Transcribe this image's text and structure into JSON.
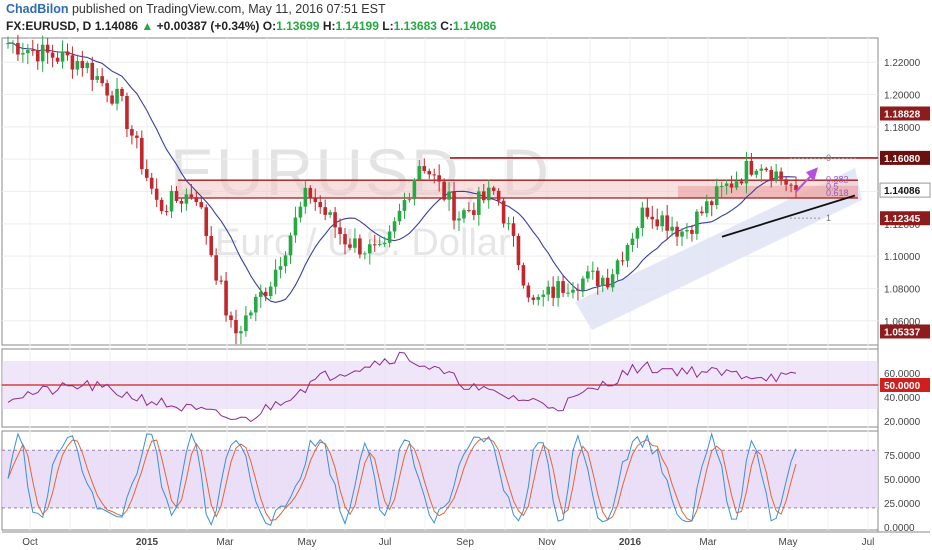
{
  "header": {
    "author": "ChadBilon",
    "published_text": "published on TradingView.com, May 11, 2016 07:51 EST",
    "symbol": "FX:EURUSD, D",
    "last": "1.14086",
    "change_arrow": "▲",
    "change": "+0.00387 (+0.34%)",
    "o_label": "O:",
    "o_value": "1.13699",
    "h_label": "H:",
    "h_value": "1.14199",
    "l_label": "L:",
    "l_value": "1.13683",
    "c_label": "C:",
    "c_value": "1.14086"
  },
  "watermark": {
    "line1": "EURUSD, D",
    "line2": "Euro / U.S. Dollar"
  },
  "colors": {
    "up": "#27a844",
    "down": "#c1272d",
    "resistance": "#a11b1b",
    "zone_fill": "#f4c6c6",
    "channel_fill": "#dfe3f5",
    "ma": "#3a3f9c",
    "rsi": "#8a2d8d",
    "stoch_k": "#3b8fd9",
    "stoch_d": "#e0673a",
    "osc_fill": "#e6d6f5",
    "arrow": "#b84fe0"
  },
  "chart_data": [
    {
      "type": "candlestick",
      "panel": "price",
      "title": "EURUSD, D",
      "subtitle": "Euro / U.S. Dollar",
      "ylim": [
        1.045,
        1.235
      ],
      "y_ticks": [
        "1.22000",
        "1.20000",
        "1.18000",
        "1.16000",
        "1.14000",
        "1.12000",
        "1.10000",
        "1.08000",
        "1.06000"
      ],
      "y_tick_values": [
        1.22,
        1.2,
        1.18,
        1.16,
        1.14,
        1.12,
        1.1,
        1.08,
        1.06
      ],
      "x_tick_labels": [
        "Oct",
        "2015",
        "Mar",
        "May",
        "Jul",
        "Sep",
        "Nov",
        "2016",
        "Mar",
        "May",
        "Jul"
      ],
      "price_labels": [
        {
          "text": "1.18828",
          "value": 1.18828
        },
        {
          "text": "1.16080",
          "value": 1.1608
        },
        {
          "text": "1.14086",
          "value": 1.14086,
          "current": true
        },
        {
          "text": "1.12345",
          "value": 1.12345
        },
        {
          "text": "1.05337",
          "value": 1.05337
        }
      ],
      "keypoints": [
        {
          "month": "Sep 2014",
          "close": 1.232
        },
        {
          "month": "Oct 2014",
          "close": 1.225
        },
        {
          "month": "Nov 2014",
          "close": 1.22
        },
        {
          "month": "Dec 2014",
          "close": 1.195
        },
        {
          "month": "Jan 2015",
          "close": 1.13
        },
        {
          "month": "Feb 2015",
          "close": 1.14
        },
        {
          "month": "Mar 2015",
          "close": 1.05
        },
        {
          "month": "Apr 2015",
          "close": 1.085
        },
        {
          "month": "May 2015",
          "close": 1.14
        },
        {
          "month": "Jun 2015",
          "close": 1.11
        },
        {
          "month": "Jul 2015",
          "close": 1.1
        },
        {
          "month": "Aug 2015",
          "close": 1.16
        },
        {
          "month": "Sep 2015",
          "close": 1.125
        },
        {
          "month": "Oct 2015",
          "close": 1.14
        },
        {
          "month": "Nov 2015",
          "close": 1.07
        },
        {
          "month": "Dec 2015",
          "close": 1.085
        },
        {
          "month": "Jan 2016",
          "close": 1.087
        },
        {
          "month": "Feb 2016",
          "close": 1.13
        },
        {
          "month": "Mar 2016",
          "close": 1.115
        },
        {
          "month": "Apr 2016",
          "close": 1.14
        },
        {
          "month": "May 2016",
          "close": 1.16
        },
        {
          "month": "May 11 2016",
          "close": 1.14086
        }
      ],
      "levels": {
        "resistance_top": 1.1608,
        "zone_top": 1.147,
        "zone_bottom": 1.136
      },
      "fib_labels": [
        {
          "text": "0",
          "value": 1.1608
        },
        {
          "text": "0.382",
          "value": 1.1475
        },
        {
          "text": "0.5",
          "value": 1.143
        },
        {
          "text": "0.618",
          "value": 1.139
        },
        {
          "text": "1",
          "value": 1.1235
        }
      ]
    },
    {
      "type": "line",
      "panel": "rsi",
      "ylim": [
        15,
        80
      ],
      "y_ticks": [
        "60.0000",
        "50.0000",
        "40.0000",
        "20.0000"
      ],
      "y_tick_values": [
        60,
        50,
        40,
        20
      ],
      "band": [
        30,
        70
      ],
      "highlight_level": {
        "text": "50.0000",
        "value": 50
      },
      "keypoints": [
        {
          "x": 0,
          "y": 40
        },
        {
          "x": 0.1,
          "y": 50
        },
        {
          "x": 0.15,
          "y": 34
        },
        {
          "x": 0.25,
          "y": 20
        },
        {
          "x": 0.33,
          "y": 57
        },
        {
          "x": 0.5,
          "y": 75
        },
        {
          "x": 0.6,
          "y": 45
        },
        {
          "x": 0.7,
          "y": 32
        },
        {
          "x": 0.8,
          "y": 65
        },
        {
          "x": 0.9,
          "y": 60
        },
        {
          "x": 1,
          "y": 56
        }
      ]
    },
    {
      "type": "line",
      "panel": "stochastic",
      "ylim": [
        -3,
        100
      ],
      "y_ticks": [
        "75.0000",
        "50.0000",
        "25.0000",
        "0.0000"
      ],
      "y_tick_values": [
        75,
        50,
        25,
        0
      ],
      "band": [
        20,
        80
      ]
    }
  ]
}
